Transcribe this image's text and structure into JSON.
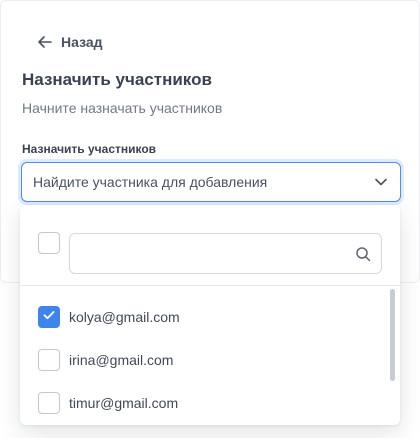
{
  "back": {
    "label": "Назад"
  },
  "header": {
    "title": "Назначить участников",
    "subtitle": "Начните назначать участников"
  },
  "field": {
    "label": "Назначить участников",
    "placeholder": "Найдите участника для добавления"
  },
  "dropdown": {
    "select_all_checked": false,
    "search_value": "",
    "options": [
      {
        "email": "kolya@gmail.com",
        "checked": true
      },
      {
        "email": "irina@gmail.com",
        "checked": false
      },
      {
        "email": "timur@gmail.com",
        "checked": false
      }
    ]
  },
  "colors": {
    "accent": "#3f84ec",
    "focus_border": "#4c8df0",
    "text_primary": "#3a4250",
    "text_secondary": "#727985"
  },
  "icons": {
    "back": "arrow-left-icon",
    "dropdown": "chevron-down-icon",
    "search": "search-icon",
    "check": "checkmark-icon"
  }
}
